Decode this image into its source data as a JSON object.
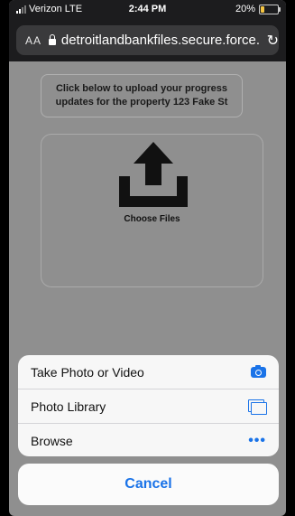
{
  "status_bar": {
    "carrier": "Verizon LTE",
    "time": "2:44 PM",
    "battery_text": "20%",
    "battery_level": 0.2,
    "battery_color": "#f5c542"
  },
  "browser": {
    "text_size_label": "AA",
    "url": "detroitlandbankfiles.secure.force.",
    "lock_icon": "lock-icon",
    "reload_icon": "reload-icon"
  },
  "page": {
    "instruction": "Click below to upload your progress updates for the property 123 Fake St",
    "upload_icon": "upload-icon",
    "choose_files_label": "Choose Files"
  },
  "action_sheet": {
    "options": [
      {
        "label": "Take Photo or Video",
        "icon": "camera-icon"
      },
      {
        "label": "Photo Library",
        "icon": "photo-library-icon"
      },
      {
        "label": "Browse",
        "icon": "more-icon"
      }
    ],
    "cancel_label": "Cancel",
    "accent_color": "#1a73e8"
  }
}
